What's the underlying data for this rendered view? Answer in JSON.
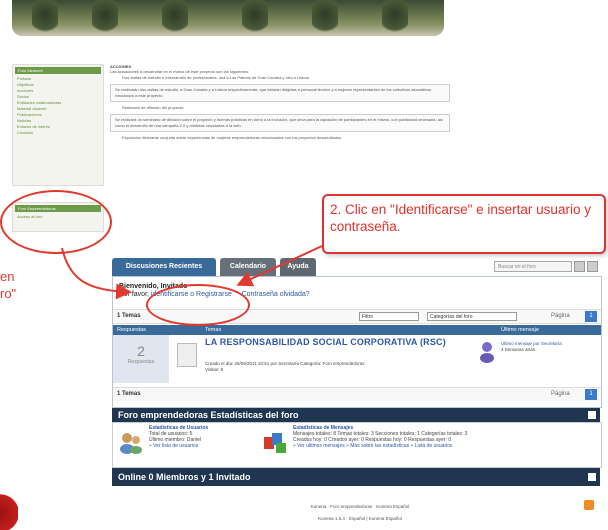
{
  "sidebar": {
    "header": "Foro Ideasnet",
    "items": [
      "Portada",
      "Objetivos",
      "Acciones",
      "Socios",
      "Entidades colaboradoras",
      "Material docente",
      "Publicaciones",
      "Noticias",
      "Enlaces de interés",
      "Contacto"
    ],
    "header2": "Foro Emprendedoras",
    "item2": "Acceso al foro"
  },
  "content": {
    "title": "ACCIONES",
    "intro": "Las actuaciones a desarrollar en el marco de este proyecto son las siguientes:",
    "bullet1": "Dos visitas de estudio e intercambio de profesionales, una a Las Palmas de Gran Canaria y otra a Lisboa.",
    "box1": "Se realizarán dos visitas de estudio, a Gran Canaria y a Lisboa respectivamente, que estarán dirigidas a personal técnico y a mujeres representantes de los colectivos asociativos vinculados a este proyecto.",
    "bullet2": "Seminario de difusión del proyecto.",
    "box2": "Se realizará un seminario de difusión sobre el proyecto y buenas prácticas en torno a la inclusión, que sirva para la captación de participantes en el mismo, con publicidad necesaria, así como el desarrollo de una campaña 2.0 y medidas vinculadas a la web.",
    "bullet3": "Exposición itinerante conjunta sobre experiencias de mujeres emprendedoras relacionadas con los proyectos desarrollados."
  },
  "annotations": {
    "callout": "2. Clic en \"Identificarse\" e insertar usuario y contraseña.",
    "left_text": "en\nro\""
  },
  "forum": {
    "tabs": [
      "Discusiones Recientes",
      "Calendario",
      "Ayuda"
    ],
    "search_placeholder": "Buscar en el foro",
    "welcome_title": "Bienvenido, Invitado",
    "welcome_prefix": "Por favor,",
    "login_link": "identificarse o Registrarse",
    "password_link": "Contraseña olvidada?",
    "topics_count": "1 Temas",
    "filter_select": "Filtro",
    "category_select": "Categorías del foro",
    "page_label": "Página",
    "page_number": "1",
    "col_replies": "Respuestas",
    "col_topics": "Temas",
    "col_last": "Último mensaje",
    "topic_replies": "2",
    "topic_replies_label": "Respuestas",
    "topic_title": "LA RESPONSABILIDAD SOCIAL CORPORATIVA (RSC)",
    "topic_meta": "Creado el día: 26/09/2011 10:51 por Secretaría  Categoría: Foro emprendedoras",
    "topic_views": "Visitas: 8",
    "last_msg": "Último mensaje por Secretaría",
    "last_msg_time": "4 Semanas atrás"
  },
  "stats": {
    "bar_title": "Foro emprendedoras Estadísticas del foro",
    "users_title": "Estadísticas de Usuarios",
    "users_line1": "Total de usuarios: 5",
    "users_line2": "Último miembro: Daniel",
    "users_line3": "» Ver lista de usuarios",
    "msgs_title": "Estadísticas de Mensajes",
    "msgs_line1": "Mensajes totales: 8   Temas totales: 3   Secciones totales: 1   Categorías totales: 3",
    "msgs_line2": "Creados hoy: 0   Creados ayer: 0   Respuestas hoy: 0   Respuestas ayer: 0",
    "msgs_line3": "» Ver últimos mensajes » Más sobre las estadísticas » Lista de usuarios"
  },
  "online": {
    "bar_title": "Online 0 Miembros y 1 Invitado"
  },
  "footer": {
    "line1": "Kunena · Foro emprendedoras · Kunena Español",
    "line2": "Kunena 1.6.4 · Español | Kunena Español"
  },
  "colors": {
    "accent": "#3a6a9a",
    "dark_bar": "#1f3550",
    "annotation_red": "#e03a2f",
    "sidebar_green": "#6d9b4a"
  }
}
